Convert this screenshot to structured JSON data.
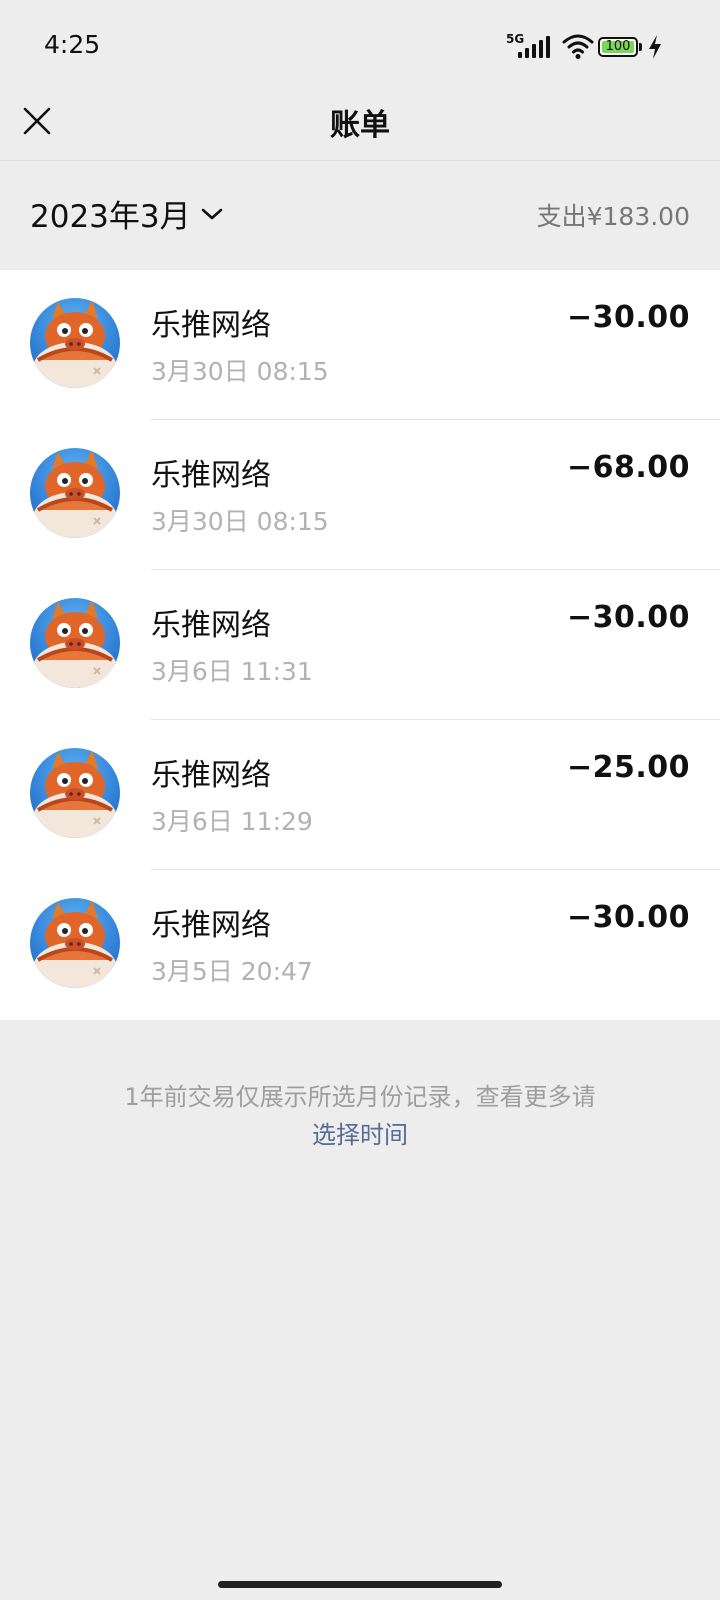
{
  "status_bar": {
    "time": "4:25",
    "network": "5G",
    "battery": "100"
  },
  "header": {
    "title": "账单",
    "close_icon": "close-icon"
  },
  "filter": {
    "month": "2023年3月",
    "expense_summary": "支出¥183.00"
  },
  "transactions": [
    {
      "merchant": "乐推网络",
      "datetime": "3月30日 08:15",
      "amount": "−30.00"
    },
    {
      "merchant": "乐推网络",
      "datetime": "3月30日 08:15",
      "amount": "−68.00"
    },
    {
      "merchant": "乐推网络",
      "datetime": "3月6日 11:31",
      "amount": "−30.00"
    },
    {
      "merchant": "乐推网络",
      "datetime": "3月6日 11:29",
      "amount": "−25.00"
    },
    {
      "merchant": "乐推网络",
      "datetime": "3月5日 20:47",
      "amount": "−30.00"
    }
  ],
  "footer": {
    "note": "1年前交易仅展示所选月份记录，查看更多请",
    "link": "选择时间"
  },
  "colors": {
    "background": "#ededed",
    "link": "#576b95",
    "battery_fill": "#7bd65a"
  }
}
